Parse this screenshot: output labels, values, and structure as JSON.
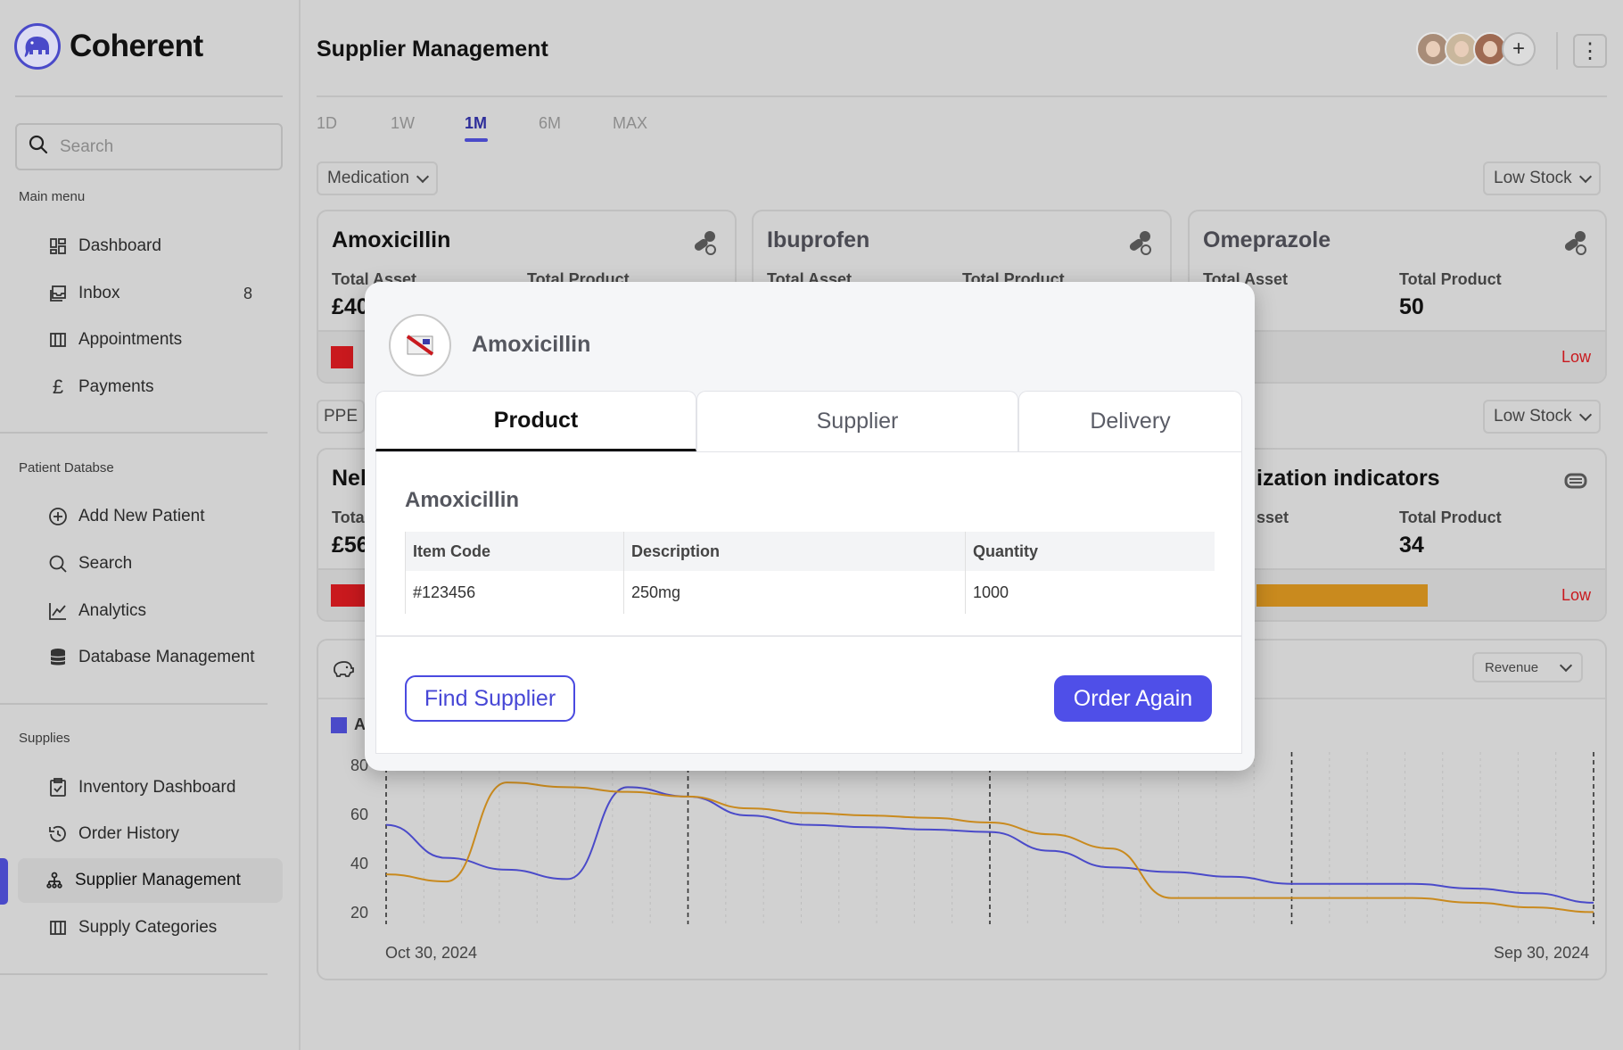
{
  "app": {
    "name": "Coherent"
  },
  "sidebar": {
    "search_placeholder": "Search",
    "sections": [
      {
        "label": "Main menu",
        "items": [
          {
            "label": "Dashboard",
            "icon": "dashboard-icon"
          },
          {
            "label": "Inbox",
            "icon": "inbox-icon",
            "badge": "8"
          },
          {
            "label": "Appointments",
            "icon": "appointments-icon"
          },
          {
            "label": "Payments",
            "icon": "pound-icon"
          }
        ]
      },
      {
        "label": "Patient Databse",
        "items": [
          {
            "label": "Add New Patient",
            "icon": "plus-circle-icon"
          },
          {
            "label": "Search",
            "icon": "search-icon"
          },
          {
            "label": "Analytics",
            "icon": "analytics-icon"
          },
          {
            "label": "Database Management",
            "icon": "database-icon"
          }
        ]
      },
      {
        "label": "Supplies",
        "items": [
          {
            "label": "Inventory Dashboard",
            "icon": "clipboard-icon"
          },
          {
            "label": "Order History",
            "icon": "history-icon"
          },
          {
            "label": "Supplier Management",
            "icon": "org-chart-icon",
            "active": true
          },
          {
            "label": "Supply Categories",
            "icon": "categories-icon"
          }
        ]
      }
    ]
  },
  "header": {
    "title": "Supplier Management",
    "add_symbol": "+",
    "more_symbol": "⋮"
  },
  "ranges": [
    "1D",
    "1W",
    "1M",
    "6M",
    "MAX"
  ],
  "active_range": "1M",
  "filters": {
    "category_1": "Medication",
    "stock_1": "Low Stock",
    "category_2": "PPE",
    "stock_2": "Low Stock",
    "chart_metric": "Revenue"
  },
  "cards": [
    {
      "title": "Amoxicillin",
      "asset_label": "Total Asset",
      "asset_value": "£40",
      "product_label": "Total Product",
      "status": "",
      "bar_color": "#c9191e"
    },
    {
      "title": "Ibuprofen",
      "asset_label": "Total Asset",
      "product_label": "Total Product"
    },
    {
      "title": "Omeprazole",
      "asset_label": "Total Asset",
      "product_label": "Total Product",
      "product_value": "50",
      "status": "Low"
    },
    {
      "title": "Nel",
      "asset_label": "Tota",
      "asset_value": "£56",
      "bar_color": "#c9191e"
    },
    {
      "title": "ization indicators",
      "asset_label": "sset",
      "product_label": "Total Product",
      "product_value": "34",
      "status": "Low",
      "bar_color": "#c98a1e"
    }
  ],
  "chart_legend_letter": "A",
  "chart_data": {
    "type": "line",
    "x_start_label": "Oct 30, 2024",
    "x_end_label": "Sep 30, 2024",
    "yticks": [
      "80",
      "60",
      "40",
      "20"
    ],
    "ylim": [
      15,
      85
    ],
    "series": [
      {
        "color": "#4a4ac9",
        "values": [
          56,
          42,
          37,
          33,
          72,
          68,
          60,
          56,
          55,
          54,
          53,
          45,
          38,
          36,
          34,
          31,
          31,
          31,
          29,
          27,
          23
        ]
      },
      {
        "color": "#c98a1e",
        "values": [
          35,
          32,
          74,
          72,
          70,
          68,
          63,
          61,
          60,
          59,
          57,
          52,
          46,
          25,
          25,
          25,
          25,
          25,
          23,
          21,
          19
        ]
      }
    ]
  },
  "modal": {
    "title": "Amoxicillin",
    "tabs": [
      "Product",
      "Supplier",
      "Delivery"
    ],
    "active_tab": "Product",
    "product_title": "Amoxicillin",
    "table": {
      "headers": [
        "Item Code",
        "Description",
        "Quantity"
      ],
      "rows": [
        [
          "#123456",
          "250mg",
          "1000"
        ]
      ]
    },
    "find_supplier_label": "Find Supplier",
    "order_again_label": "Order Again"
  }
}
